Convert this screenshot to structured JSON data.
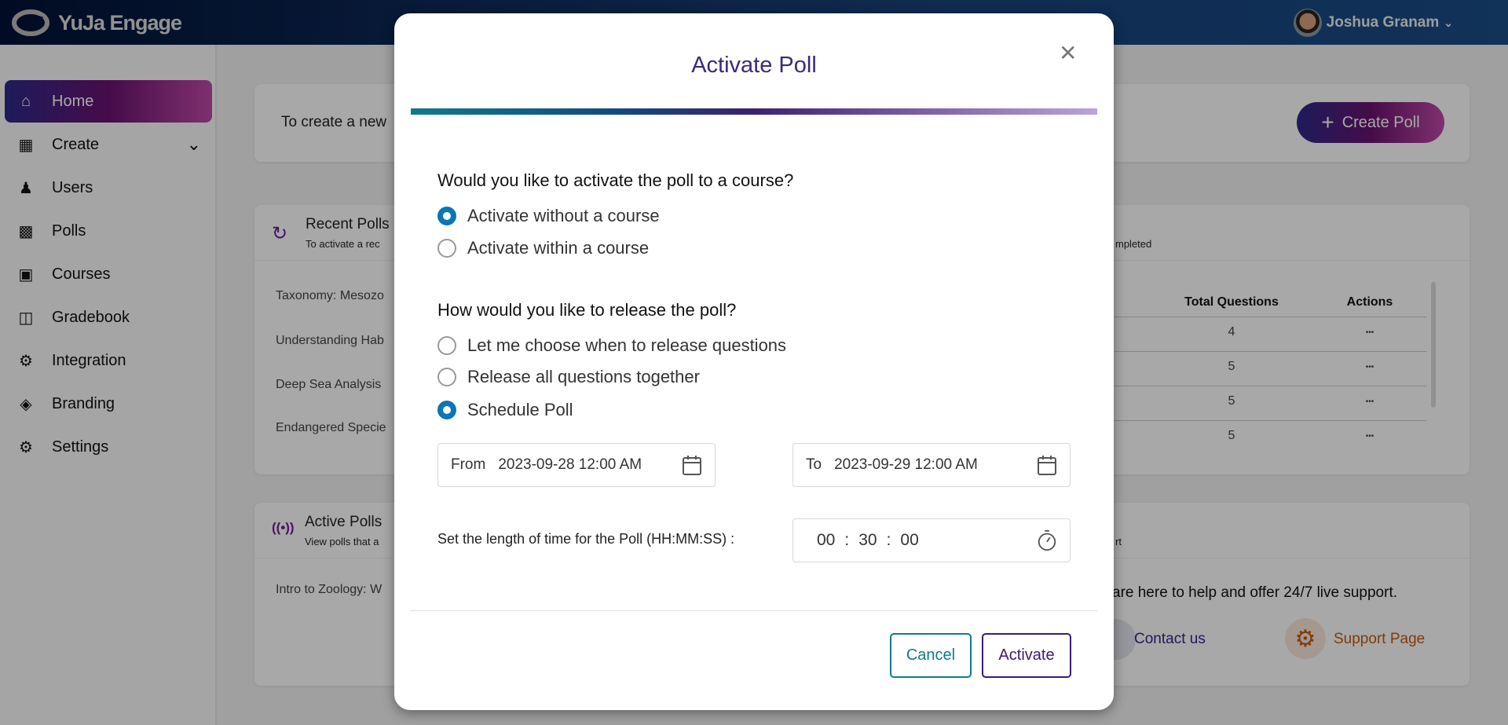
{
  "app": {
    "name": "YuJa Engage",
    "user_name": "Joshua Granam"
  },
  "sidebar": {
    "items": [
      {
        "label": "Home",
        "icon": "home-icon",
        "active": true
      },
      {
        "label": "Create",
        "icon": "create-chart-icon"
      },
      {
        "label": "Users",
        "icon": "users-icon"
      },
      {
        "label": "Polls",
        "icon": "polls-icon"
      },
      {
        "label": "Courses",
        "icon": "courses-icon"
      },
      {
        "label": "Gradebook",
        "icon": "gradebook-icon"
      },
      {
        "label": "Integration",
        "icon": "integration-gears-icon"
      },
      {
        "label": "Branding",
        "icon": "branding-paint-icon"
      },
      {
        "label": "Settings",
        "icon": "settings-gear-icon"
      }
    ]
  },
  "create_card": {
    "text": "To create a new",
    "button": "Create Poll"
  },
  "recent_polls": {
    "title": "Recent Polls",
    "subtitle": "To activate a rec",
    "subtitle_tail": "mpleted",
    "columns": [
      "Total Questions",
      "Actions"
    ],
    "rows": [
      {
        "name": "Taxonomy: Mesozo",
        "questions": "4",
        "actions": "•••"
      },
      {
        "name": "Understanding Hab",
        "questions": "5",
        "actions": "•••"
      },
      {
        "name": "Deep Sea Analysis",
        "questions": "5",
        "actions": "•••"
      },
      {
        "name": "Endangered Specie",
        "questions": "5",
        "actions": "•••"
      }
    ]
  },
  "active_polls": {
    "title": "Active Polls",
    "subtitle": "View polls that a",
    "subtitle_tail": "rt",
    "row": "Intro to Zoology: W"
  },
  "support": {
    "text": "are here to help and offer 24/7 live support.",
    "contact": "Contact us",
    "support_page": "Support Page"
  },
  "modal": {
    "title": "Activate Poll",
    "q1": "Would you like to activate the poll to a course?",
    "q1_options": [
      {
        "label": "Activate without a course",
        "selected": true
      },
      {
        "label": "Activate within a course",
        "selected": false
      }
    ],
    "q2": "How would you like to release the poll?",
    "q2_options": [
      {
        "label": "Let me choose when to release questions",
        "selected": false
      },
      {
        "label": "Release all questions together",
        "selected": false
      },
      {
        "label": "Schedule Poll",
        "selected": true
      }
    ],
    "from_label": "From",
    "from_value": "2023-09-28 12:00 AM",
    "to_label": "To",
    "to_value": "2023-09-29 12:00 AM",
    "duration_label": "Set the length of time for the Poll (HH:MM:SS) :",
    "duration": {
      "hh": "00",
      "mm": "30",
      "ss": "00",
      "sep": ":"
    },
    "cancel": "Cancel",
    "activate": "Activate"
  },
  "colors": {
    "accent_blue": "#0a76b6",
    "title_purple": "#3d2a78",
    "cancel_teal": "#0f7b8c",
    "activate_purple": "#3d1a78"
  }
}
